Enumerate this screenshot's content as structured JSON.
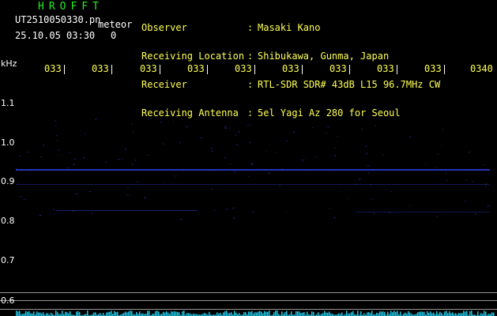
{
  "station": {
    "name": "HROFFT",
    "filename": "UT2510050330.pn",
    "mode": "meteor",
    "datetime": "25.10.05 03:30",
    "count": "0"
  },
  "header": {
    "rows": [
      {
        "label": "Observer",
        "value": "Masaki Kano"
      },
      {
        "label": "Receiving Location",
        "value": "Shibukawa, Gunma, Japan"
      },
      {
        "label": "Receiver",
        "value": "RTL-SDR SDR# 43dB L15 96.7MHz CW"
      },
      {
        "label": "Receiving Antenna",
        "value": "5el Yagi Az 280 for Seoul"
      }
    ],
    "colon": ":"
  },
  "time_axis": {
    "labels": [
      "033",
      "033",
      "033",
      "033",
      "033",
      "033",
      "033",
      "033",
      "033",
      "0340"
    ]
  },
  "freq_axis": {
    "unit": "kHz",
    "labels": [
      "1.1",
      "1.0",
      "0.9",
      "0.8",
      "0.7",
      "0.6"
    ]
  },
  "colors": {
    "background": "#000000",
    "text_yellow": "#ffff55",
    "title_green": "#22ee22",
    "signal_blue": "#3344ff",
    "spectrum_cyan": "#22ddff"
  }
}
